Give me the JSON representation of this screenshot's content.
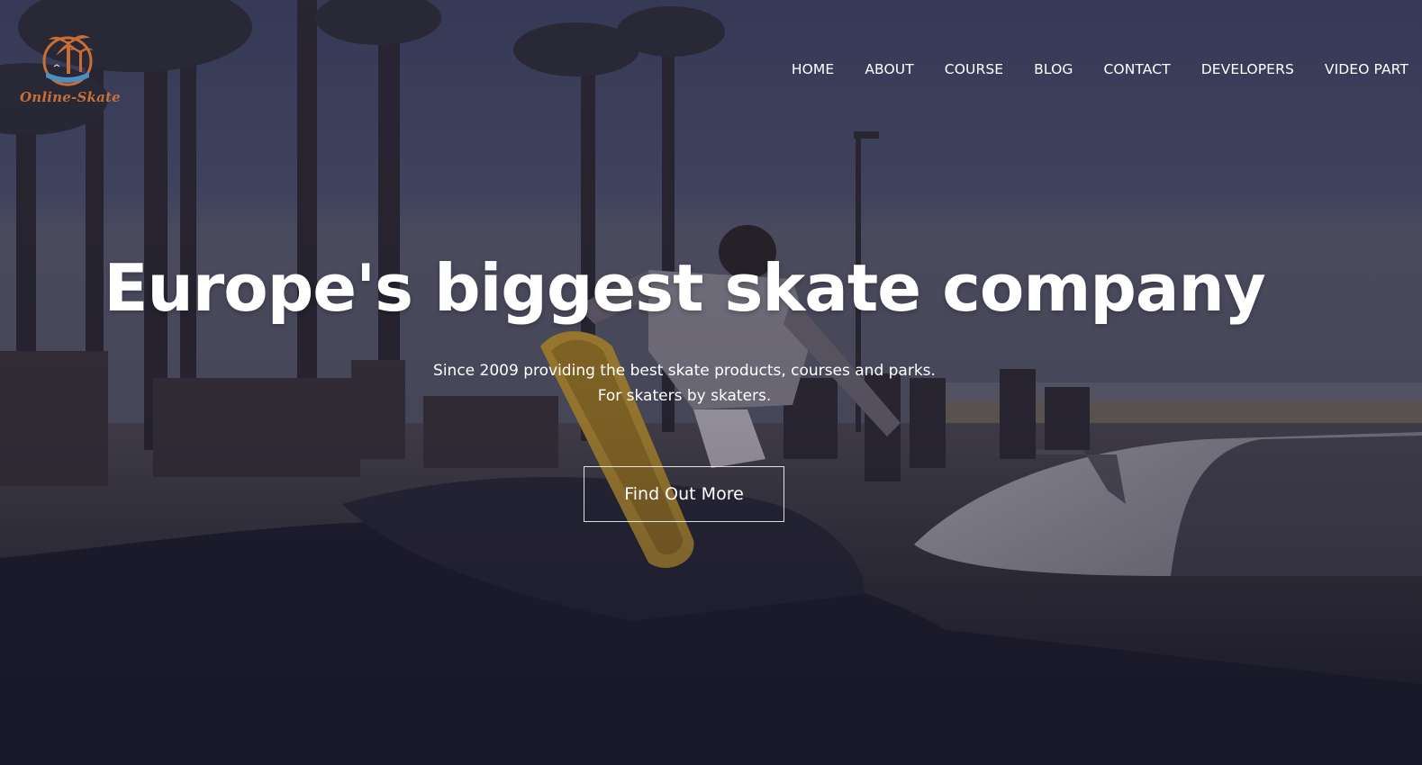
{
  "brand": {
    "logo_text": "Online-Skate",
    "logo_icon": "palm-tree-icon",
    "accent_color": "#c96f35"
  },
  "nav": {
    "items": [
      {
        "label": "HOME"
      },
      {
        "label": "ABOUT"
      },
      {
        "label": "COURSE"
      },
      {
        "label": "BLOG"
      },
      {
        "label": "CONTACT"
      },
      {
        "label": "DEVELOPERS"
      },
      {
        "label": "VIDEO PART"
      }
    ]
  },
  "hero": {
    "headline": "Europe's biggest skate company",
    "subtitle_line1": "Since 2009 providing the best skate products, courses and parks.",
    "subtitle_line2": "For skaters by skaters.",
    "cta_label": "Find Out More",
    "background_image": "skatepark-photo"
  }
}
